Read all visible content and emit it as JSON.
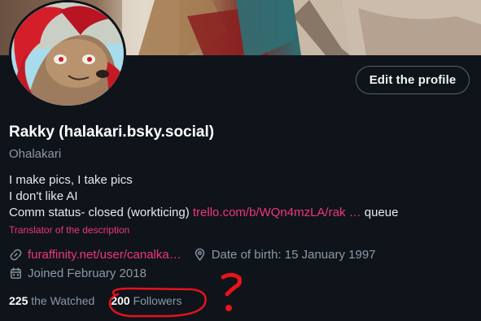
{
  "banner": {
    "image": "artwork-banner"
  },
  "avatar": {
    "image": "red-haired-hyena-character-avatar"
  },
  "actions": {
    "edit_profile": "Edit the profile"
  },
  "profile": {
    "display_name": "Rakky (halakari.bsky.social)",
    "handle": "Ohalakari",
    "bio": {
      "line1": "I make pics, I take pics",
      "line2": "I don't like AI",
      "line3_text": "Comm status- closed (workticing) ",
      "line3_link": "trello.com/b/WQn4mzLA/rak …",
      "line3_tail": " queue"
    },
    "translate_label": "Translator of the description",
    "website": "furaffinity.net/user/canalka…",
    "birth": "Date of birth: 15 January 1997",
    "joined": "Joined February 2018"
  },
  "stats": {
    "watched_count": "225",
    "watched_label": " the Watched",
    "followers_count": "200",
    "followers_label": " Followers"
  },
  "colors": {
    "background": "#0f141a",
    "accent_pink": "#f0357e",
    "muted_text": "#8b98a5",
    "annotation_red": "#e8121a"
  },
  "icons": [
    "link-icon",
    "location-pin-icon",
    "calendar-icon"
  ]
}
